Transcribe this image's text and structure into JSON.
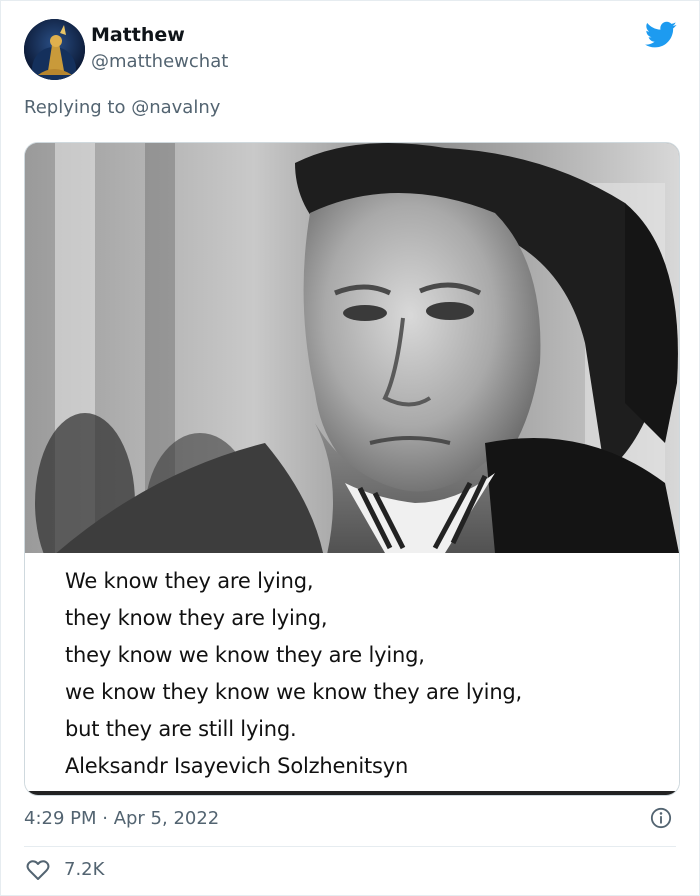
{
  "tweet": {
    "author": {
      "name": "Matthew",
      "handle": "@matthewchat"
    },
    "reply": {
      "label": "Replying to",
      "target": "@navalny"
    },
    "media": {
      "quote_lines": [
        "We know they are lying,",
        "they know they are lying,",
        "they know we know they are lying,",
        "we know they know we know they are lying,",
        "but they are still lying.",
        "Aleksandr Isayevich Solzhenitsyn"
      ]
    },
    "timestamp": "4:29 PM · Apr 5, 2022",
    "likes": "7.2K"
  },
  "colors": {
    "twitter_blue": "#1d9bf0",
    "secondary_text": "#536471",
    "border": "#cfd9de"
  },
  "icons": {
    "brand": "twitter-bird-icon",
    "info": "info-icon",
    "like": "heart-icon"
  }
}
